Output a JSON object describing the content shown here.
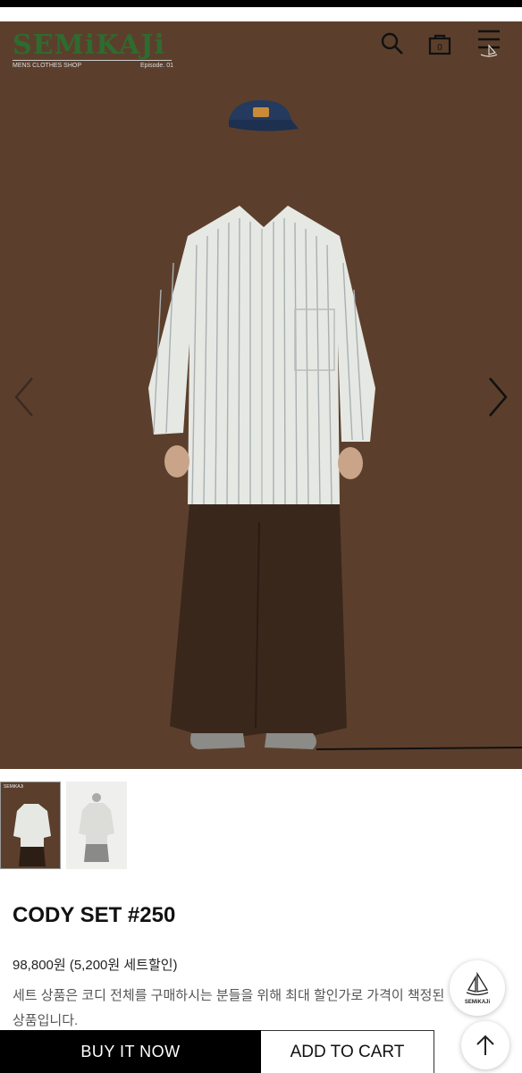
{
  "header": {
    "logo_text": "SEMiKAJi",
    "logo_subtitle": "MENS CLOTHES SHOP",
    "logo_episode": "Episode. 01",
    "icons": [
      "search-icon",
      "shopping-bag-icon",
      "menu-icon"
    ]
  },
  "gallery": {
    "prev_icon": "chevron-left-icon",
    "next_icon": "chevron-right-icon",
    "thumb_logo": "SEMiKAJi"
  },
  "product": {
    "name": "CODY SET #250",
    "price": "98,800원 (5,200원 세트할인)",
    "description": "세트 상품은 코디 전체를 구매하시는 분들을 위해 최대 할인가로 가격이 책정된 상품입니다."
  },
  "floating": {
    "brand_label": "SEMiKAJi"
  },
  "actions": {
    "buy_label": "BUY IT NOW",
    "cart_label": "ADD TO CART"
  },
  "colors": {
    "hero_bg": "#5b3f2c",
    "logo_green": "#2f6b2f",
    "buy_bg": "#000000"
  }
}
